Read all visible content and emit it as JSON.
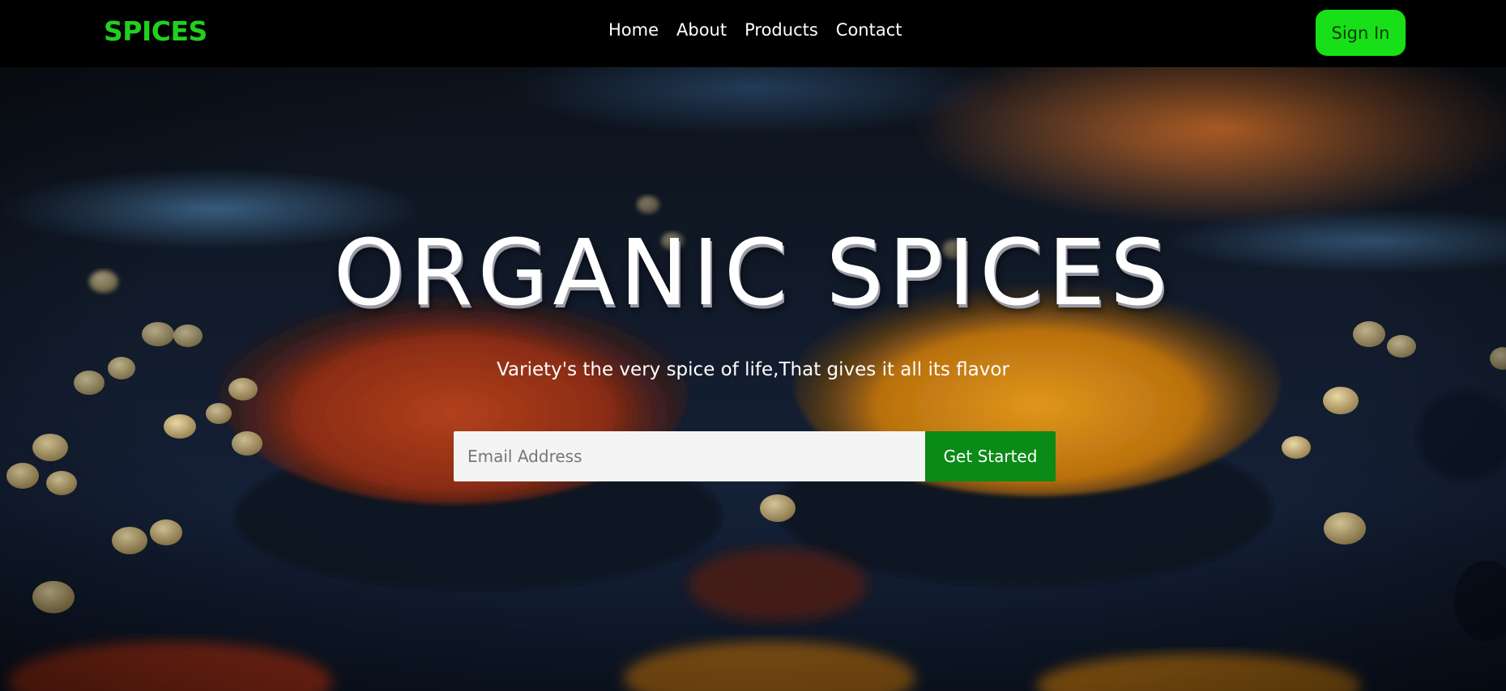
{
  "brand": {
    "logo_text": "SPICES",
    "accent_color": "#1fd11f"
  },
  "nav": {
    "links": [
      {
        "label": "Home"
      },
      {
        "label": "About"
      },
      {
        "label": "Products"
      },
      {
        "label": "Contact"
      }
    ],
    "signin_label": "Sign In",
    "signin_color": "#18e018"
  },
  "hero": {
    "title": "ORGANIC SPICES",
    "subtitle": "Variety's the very spice of life,That gives it all its flavor",
    "email_placeholder": "Email Address",
    "cta_label": "Get Started",
    "cta_color": "#0a8a16"
  }
}
